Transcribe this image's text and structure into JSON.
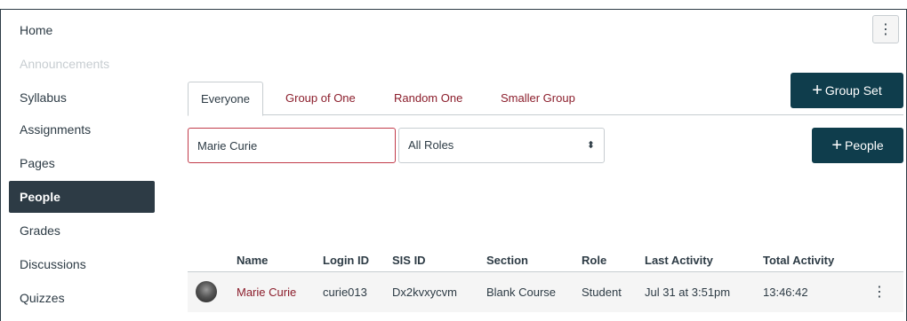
{
  "sidebar": {
    "items": [
      {
        "label": "Home"
      },
      {
        "label": "Announcements"
      },
      {
        "label": "Syllabus"
      },
      {
        "label": "Assignments"
      },
      {
        "label": "Pages"
      },
      {
        "label": "People"
      },
      {
        "label": "Grades"
      },
      {
        "label": "Discussions"
      },
      {
        "label": "Quizzes"
      }
    ]
  },
  "header": {
    "menu_glyph": "⋮"
  },
  "tabs": [
    {
      "label": "Everyone"
    },
    {
      "label": "Group of One"
    },
    {
      "label": "Random One"
    },
    {
      "label": "Smaller Group"
    }
  ],
  "actions": {
    "group_set_label": "Group Set",
    "people_label": "People",
    "plus_glyph": "+"
  },
  "filters": {
    "search_value": "Marie Curie",
    "role_selected": "All Roles",
    "role_arrows": "⬍"
  },
  "table": {
    "columns": [
      "Name",
      "Login ID",
      "SIS ID",
      "Section",
      "Role",
      "Last Activity",
      "Total Activity"
    ],
    "rows": [
      {
        "name": "Marie Curie",
        "login_id": "curie013",
        "sis_id": "Dx2kvxycvm",
        "section": "Blank Course",
        "role": "Student",
        "last_activity": "Jul 31 at 3:51pm",
        "total_activity": "13:46:42",
        "menu_glyph": "⋮"
      }
    ]
  },
  "colors": {
    "nav_active_bg": "#2d3b45",
    "button_dark": "#0f3d4c",
    "link": "#8b1d2b",
    "search_border": "#c23c4b"
  }
}
